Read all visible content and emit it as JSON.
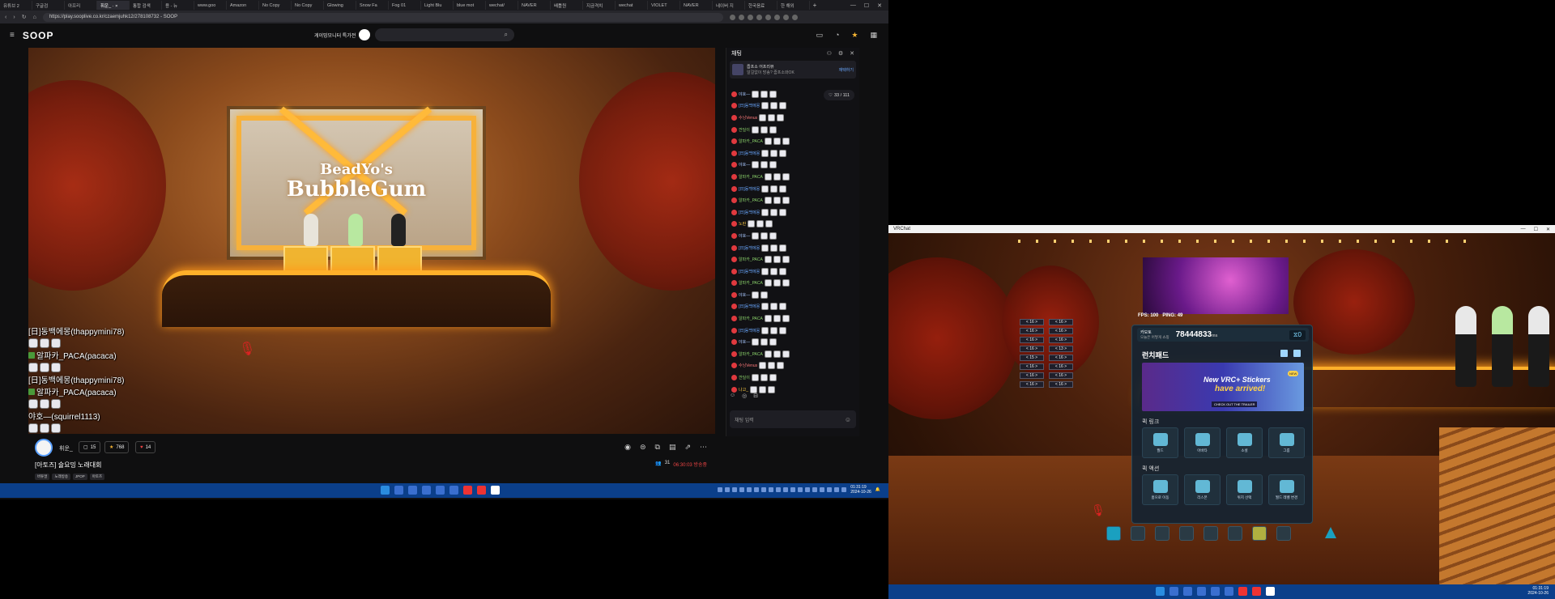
{
  "browser": {
    "tabs": [
      {
        "label": "유튜브 2",
        "active": false
      },
      {
        "label": "구글검",
        "active": false
      },
      {
        "label": "아프리",
        "active": false
      },
      {
        "label": "휘운_ · ×",
        "active": true
      },
      {
        "label": "통합 검색",
        "active": false
      },
      {
        "label": "용 - 뉴",
        "active": false
      },
      {
        "label": "www.goo",
        "active": false
      },
      {
        "label": "Amazon",
        "active": false
      },
      {
        "label": "No Copy",
        "active": false
      },
      {
        "label": "No Copy",
        "active": false
      },
      {
        "label": "Glowing",
        "active": false
      },
      {
        "label": "Snow Fa",
        "active": false
      },
      {
        "label": "Fog 01",
        "active": false
      },
      {
        "label": "Light Blu",
        "active": false
      },
      {
        "label": "blue mot",
        "active": false
      },
      {
        "label": "wechat/",
        "active": false
      },
      {
        "label": "NAVER",
        "active": false
      },
      {
        "label": "배틀원",
        "active": false
      },
      {
        "label": "지금격치",
        "active": false
      },
      {
        "label": "wechat",
        "active": false
      },
      {
        "label": "VIOLET",
        "active": false
      },
      {
        "label": "NAVER",
        "active": false
      },
      {
        "label": "네이버 지",
        "active": false
      },
      {
        "label": "한국음료",
        "active": false
      },
      {
        "label": "한 해외",
        "active": false
      }
    ],
    "new_tab": "+",
    "window_controls": [
      "—",
      "☐",
      "✕"
    ],
    "url": "https://play.sooplive.co.kr/czaemjuhk12/278108732 - SOOP"
  },
  "soop": {
    "logo": "SOOP",
    "header_center_label": "게이밍모니터 특가전",
    "search_icon": "⌕"
  },
  "video": {
    "stage_title_line1": "BeadYo's",
    "stage_title_line2": "BubbleGum",
    "overlay_chat": [
      {
        "text": "[日]동백에몽(thappymini78)",
        "emotes": 3
      },
      {
        "text": "알파카_PACA(pacaca)",
        "emotes": 3,
        "flag": true
      },
      {
        "text": "[日]동백에몽(thappymini78)",
        "emotes": 0
      },
      {
        "text": "알파카_PACA(pacaca)",
        "emotes": 3,
        "flag": true
      },
      {
        "text": "야호—(squirrel1113)",
        "emotes": 3
      }
    ]
  },
  "stream": {
    "streamer": "휘운_",
    "stat_comments": "15",
    "stat_stars": "768",
    "stat_likes": "14",
    "title": "[아토즈] 슐요밍 노래대회",
    "tags": [
      "버튜얼",
      "노래방송",
      "JPOP",
      "아토즈"
    ],
    "viewers": "31",
    "uptime": "06:30:03 방송중"
  },
  "chat": {
    "header": "채팅",
    "notice_title": "줍프소 어프리뷰",
    "notice_body": "알걸없이 방송? 줍프소와OK",
    "notice_link": "재택하기",
    "participants": "33 / 111",
    "input_placeholder": "채팅 입력",
    "lines": [
      {
        "name": "야호—",
        "color": "#a8c8ff",
        "emotes": 3
      },
      {
        "name": "[日]동백에몽",
        "color": "#6aa8ff",
        "emotes": 3
      },
      {
        "name": "수닝Venus",
        "color": "#ff7a7a",
        "emotes": 3
      },
      {
        "name": "깐딜이",
        "color": "#8ad06a",
        "emotes": 3
      },
      {
        "name": "알파카_PACA",
        "color": "#8ad06a",
        "emotes": 3
      },
      {
        "name": "[日]동백에몽",
        "color": "#6aa8ff",
        "emotes": 3
      },
      {
        "name": "야호—",
        "color": "#a8c8ff",
        "emotes": 3
      },
      {
        "name": "알파카_PACA",
        "color": "#8ad06a",
        "emotes": 3
      },
      {
        "name": "[日]동백에몽",
        "color": "#6aa8ff",
        "emotes": 3
      },
      {
        "name": "알파카_PACA",
        "color": "#8ad06a",
        "emotes": 3
      },
      {
        "name": "[日]동백에몽",
        "color": "#6aa8ff",
        "emotes": 3
      },
      {
        "name": "노란",
        "color": "#ffcc44",
        "emotes": 3
      },
      {
        "name": "야호—",
        "color": "#a8c8ff",
        "emotes": 3
      },
      {
        "name": "[日]동백에몽",
        "color": "#6aa8ff",
        "emotes": 3
      },
      {
        "name": "알파카_PACA",
        "color": "#8ad06a",
        "emotes": 3
      },
      {
        "name": "[日]동백에몽",
        "color": "#6aa8ff",
        "emotes": 3
      },
      {
        "name": "알파카_PACA",
        "color": "#8ad06a",
        "emotes": 3
      },
      {
        "name": "야호—",
        "color": "#a8c8ff",
        "emotes": 2
      },
      {
        "name": "[日]동백에몽",
        "color": "#6aa8ff",
        "emotes": 3
      },
      {
        "name": "알파카_PACA",
        "color": "#8ad06a",
        "emotes": 3
      },
      {
        "name": "[日]동백에몽",
        "color": "#6aa8ff",
        "emotes": 3
      },
      {
        "name": "야호—",
        "color": "#a8c8ff",
        "emotes": 3
      },
      {
        "name": "알파카_PACA",
        "color": "#8ad06a",
        "emotes": 3
      },
      {
        "name": "수닝Venus",
        "color": "#ff7a7a",
        "emotes": 3
      },
      {
        "name": "깐딜이",
        "color": "#8ad06a",
        "emotes": 3
      },
      {
        "name": "나고_",
        "color": "#ffcc44",
        "emotes": 3
      }
    ]
  },
  "taskbar_left": {
    "time": "01:31:19",
    "date": "2024-10-26"
  },
  "vrchat": {
    "window_title": "VRChat",
    "fps": "FPS: 100",
    "ping": "PING: 49",
    "world_name": "카모토",
    "world_sub": "오늘은 어떻게 쇼핑",
    "ms_value": "78444833",
    "ms_unit": "ms",
    "counter": "0",
    "launchpad_title": "런치패드",
    "banner_line1": "New VRC+ Stickers",
    "banner_line2": "have arrived!",
    "banner_cta": "CHECK OUT THE TRAILER",
    "banner_new": "NEW",
    "quick_links_label": "퀵 링크",
    "quick_links": [
      "월드",
      "아바타",
      "소셜",
      "그룹"
    ],
    "quick_actions_label": "퀵 액션",
    "quick_actions": [
      "홈으로 이동",
      "리스폰",
      "위치 선택",
      "월드 레벨 변경"
    ],
    "board_values": [
      "< 16 >",
      "< 16 >",
      "< 16 >",
      "< 16 >",
      "< 15 >",
      "< 16 >",
      "< 16 >",
      "< 16 >"
    ],
    "board_values_col2": [
      "< 16 >",
      "< 16 >",
      "< 16 >",
      "< 13 >",
      "< 16 >",
      "< 16 >",
      "< 16 >",
      "< 16 >"
    ]
  },
  "taskbar_right": {
    "time": "01:31:19",
    "date": "2024-10-26"
  }
}
